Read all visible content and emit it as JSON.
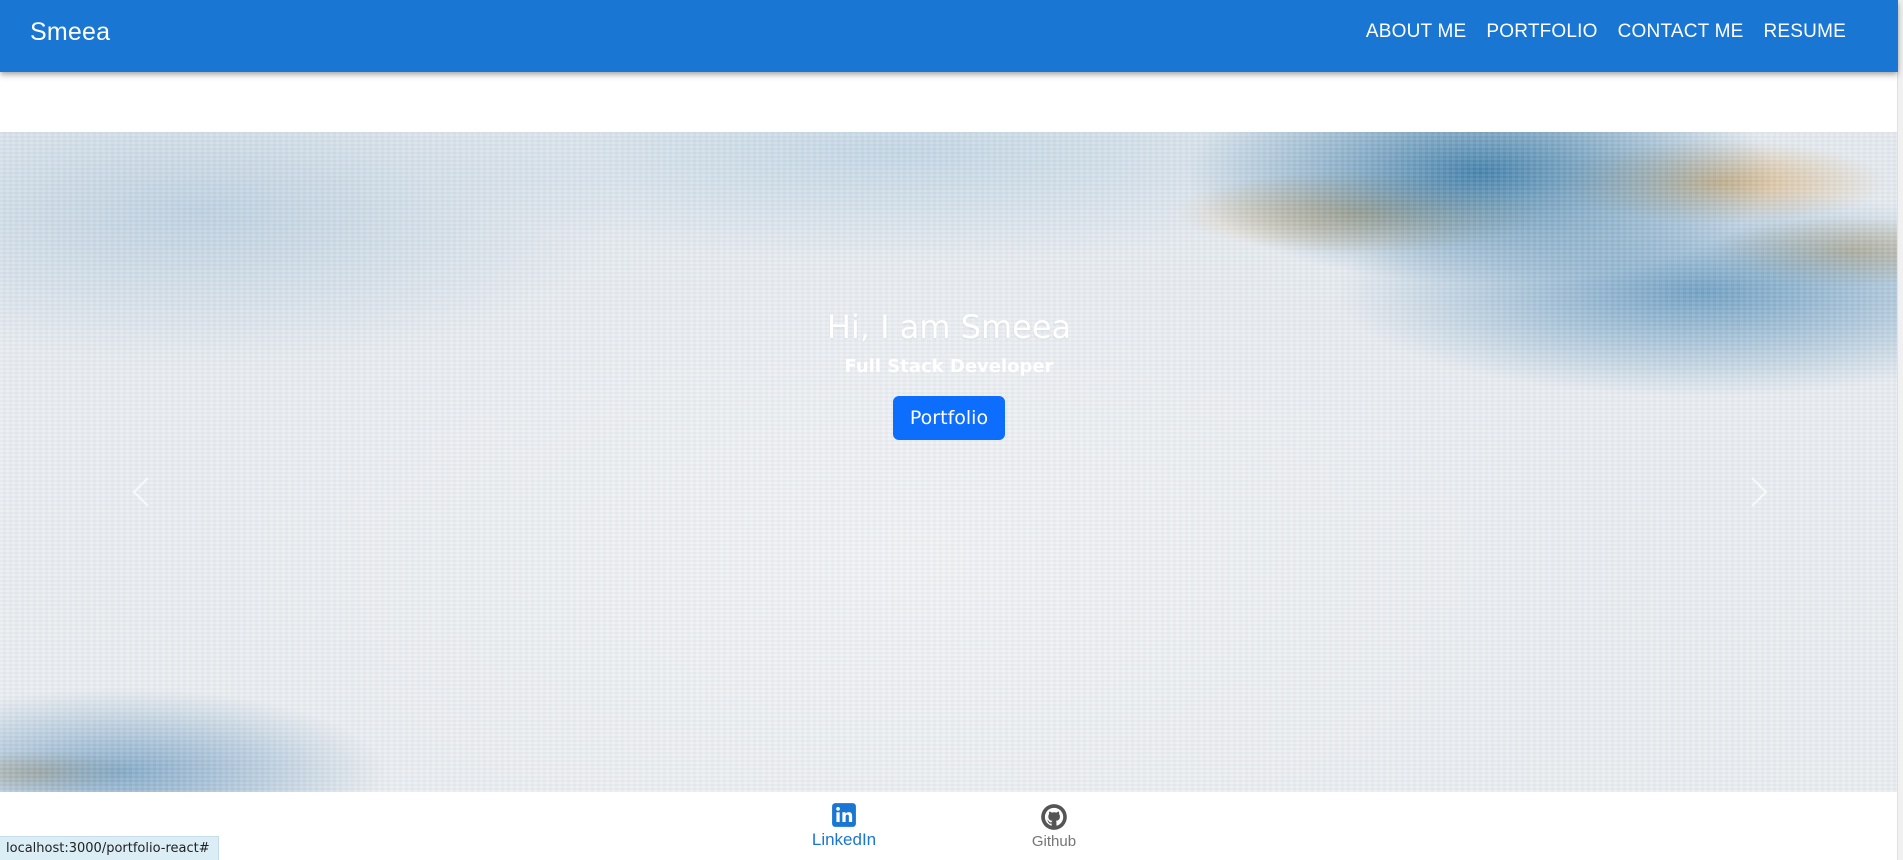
{
  "header": {
    "brand": "Smeea",
    "nav": [
      {
        "label": "ABOUT ME"
      },
      {
        "label": "PORTFOLIO"
      },
      {
        "label": "CONTACT ME"
      },
      {
        "label": "RESUME"
      }
    ]
  },
  "hero": {
    "title": "Hi, I am Smeea",
    "subtitle": "Full Stack Developer",
    "button_label": "Portfolio",
    "prev_icon": "chevron-left-icon",
    "next_icon": "chevron-right-icon"
  },
  "bottom_nav": {
    "items": [
      {
        "label": "LinkedIn",
        "icon": "linkedin-icon",
        "active": true
      },
      {
        "label": "Github",
        "icon": "github-icon",
        "active": false
      }
    ]
  },
  "status_bar": {
    "url": "localhost:3000/portfolio-react#"
  },
  "colors": {
    "app_bar": "#1976d2",
    "primary_button": "#0d6efd",
    "active_nav": "#1976d2",
    "inactive_nav": "#757575"
  }
}
